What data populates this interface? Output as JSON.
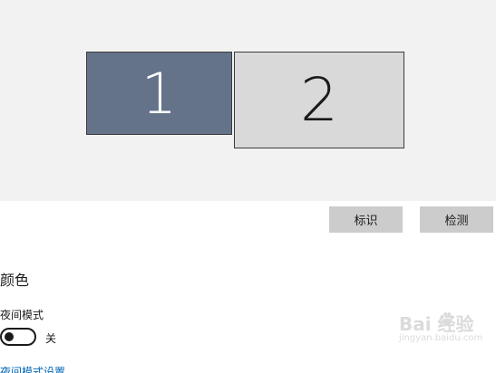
{
  "display": {
    "monitors": [
      {
        "label": "1",
        "selected": true
      },
      {
        "label": "2",
        "selected": false
      }
    ],
    "identify_label": "标识",
    "detect_label": "检测"
  },
  "color": {
    "section_title": "颜色",
    "night_light_label": "夜间模式",
    "night_light_state": "关",
    "night_light_on": false,
    "settings_link": "夜间模式设置"
  },
  "watermark": {
    "brand": "Bai  经验",
    "url": "jingyan.baidu.com"
  },
  "colors": {
    "selected_monitor": "#64738a",
    "unselected_monitor": "#d9d9d9",
    "button_bg": "#cccccc",
    "link": "#0067b8"
  }
}
